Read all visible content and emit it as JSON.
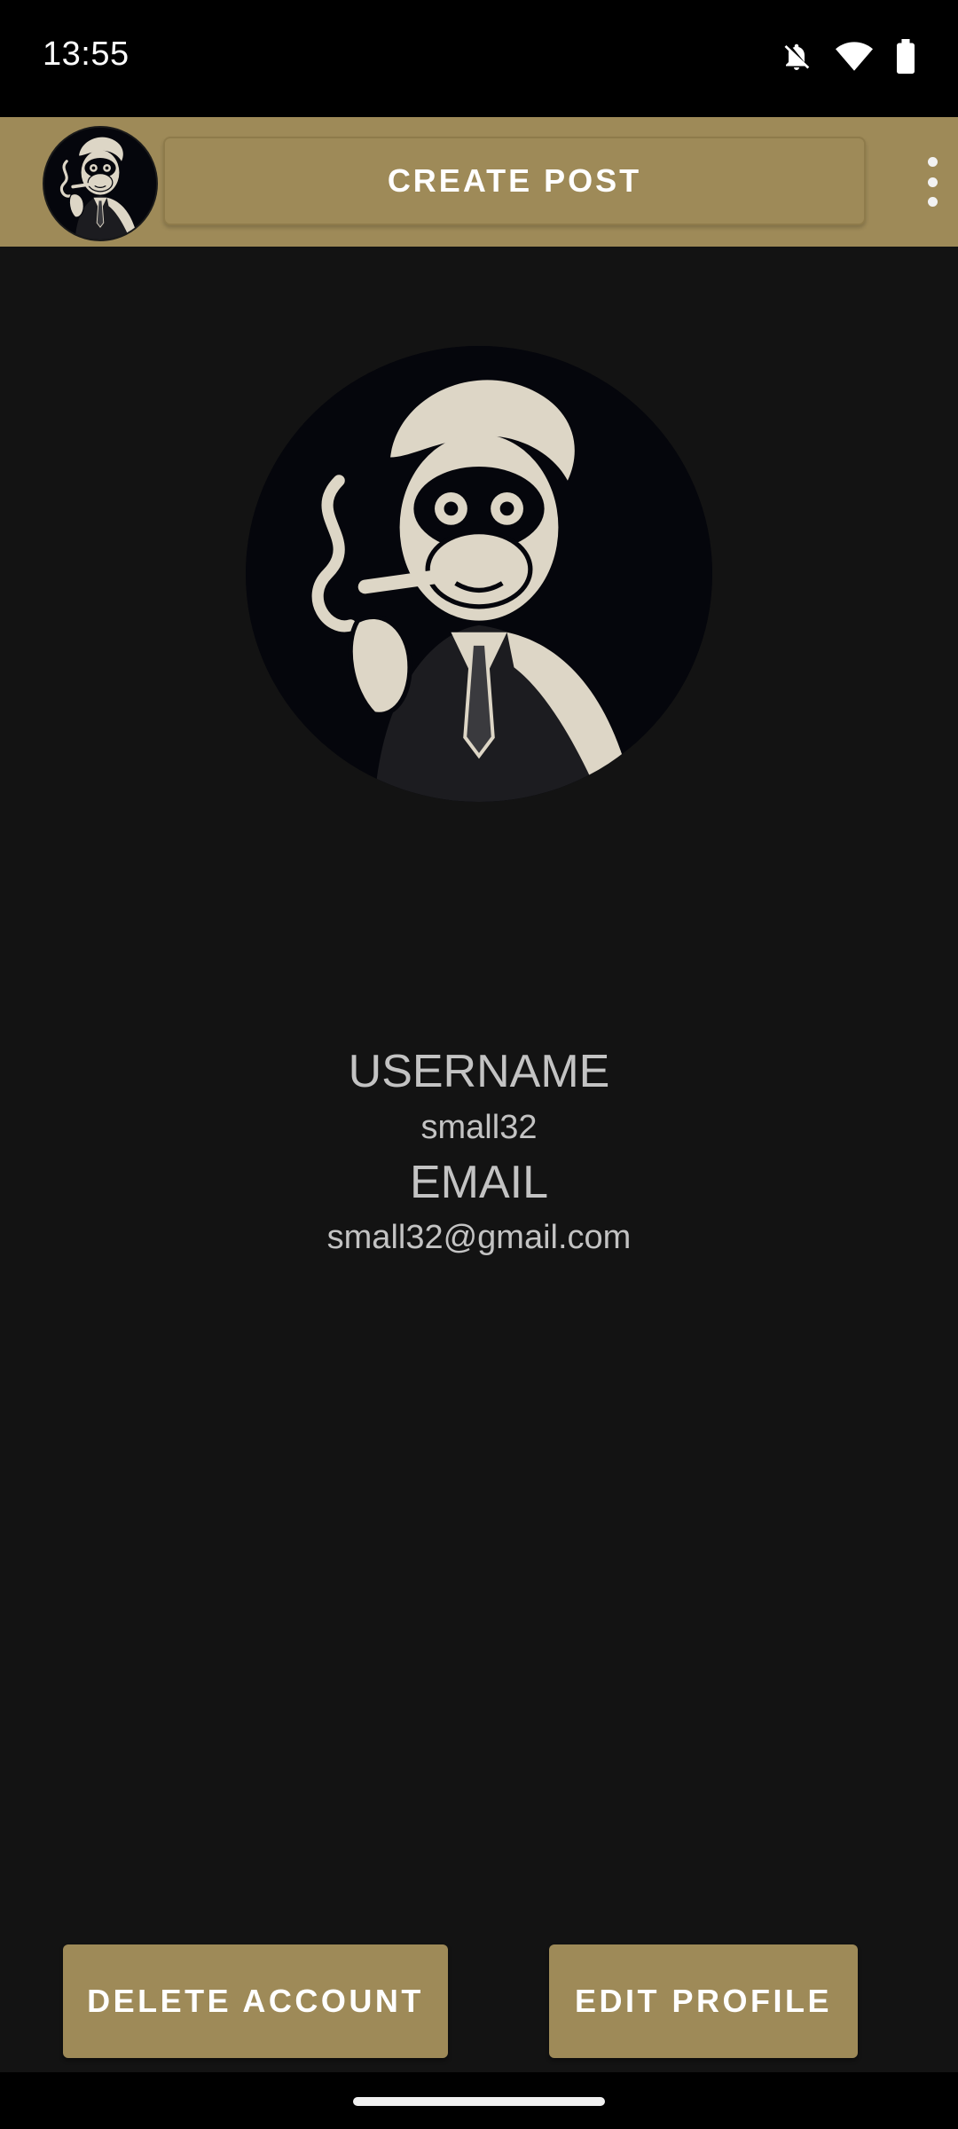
{
  "status_bar": {
    "time": "13:55",
    "icons": [
      "bell-off-icon",
      "wifi-icon",
      "battery-icon"
    ]
  },
  "app_bar": {
    "create_post_label": "CREATE POST",
    "menu_icon": "more-vert-icon",
    "avatar": "profile-avatar-monkey"
  },
  "profile": {
    "username_label": "USERNAME",
    "username": "small32",
    "email_label": "EMAIL",
    "email": "small32@gmail.com"
  },
  "actions": {
    "delete_label": "DELETE ACCOUNT",
    "edit_label": "EDIT PROFILE"
  },
  "colors": {
    "accent": "#9e8a58",
    "background": "#131313",
    "text": "#c3c3c3"
  }
}
